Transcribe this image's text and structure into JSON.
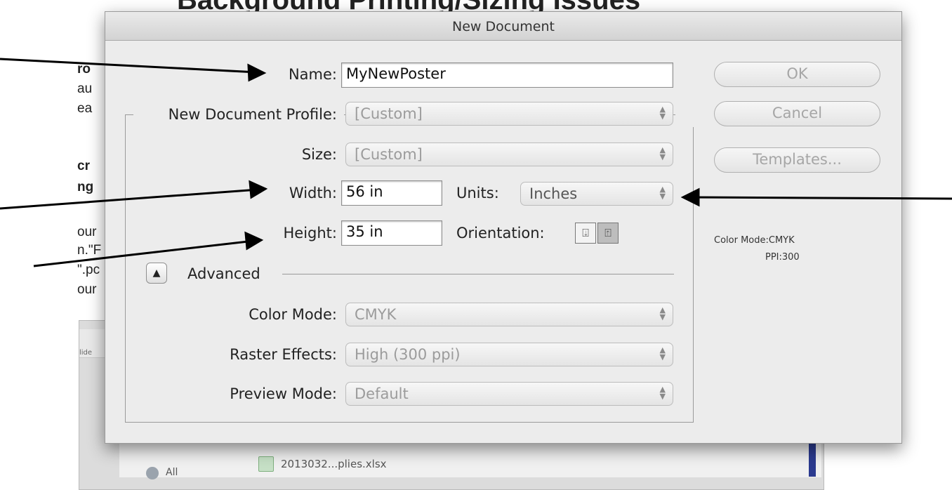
{
  "background": {
    "heading": "Background Printing/Sizing Issues",
    "lines": [
      "ro",
      "au",
      "ea",
      "cr",
      "ng",
      "our",
      "n.\"F",
      "\".pc",
      "our"
    ],
    "file_name": "2013032...plies.xlsx",
    "sidebar_item": "All",
    "slide_label": "lide"
  },
  "dialog": {
    "title": "New Document",
    "name_label": "Name:",
    "name_value": "MyNewPoster",
    "profile_label": "New Document Profile:",
    "profile_value": "[Custom]",
    "size_label": "Size:",
    "size_value": "[Custom]",
    "width_label": "Width:",
    "width_value": "56 in",
    "units_label": "Units:",
    "units_value": "Inches",
    "height_label": "Height:",
    "height_value": "35 in",
    "orientation_label": "Orientation:",
    "advanced_label": "Advanced",
    "color_mode_label": "Color Mode:",
    "color_mode_value": "CMYK",
    "raster_label": "Raster Effects:",
    "raster_value": "High (300 ppi)",
    "preview_label": "Preview Mode:",
    "preview_value": "Default",
    "ok_label": "OK",
    "cancel_label": "Cancel",
    "templates_label": "Templates...",
    "info_color_mode": "Color Mode:CMYK",
    "info_ppi": "PPI:300"
  },
  "icons": {
    "select_arrows": "updown-chevron-icon",
    "disclosure": "triangle-up-icon",
    "portrait": "portrait-orientation-icon",
    "landscape": "landscape-orientation-icon"
  },
  "colors": {
    "dialog_bg": "#ececec",
    "arrow": "#000000",
    "disabled_text": "#a6a6a6"
  }
}
